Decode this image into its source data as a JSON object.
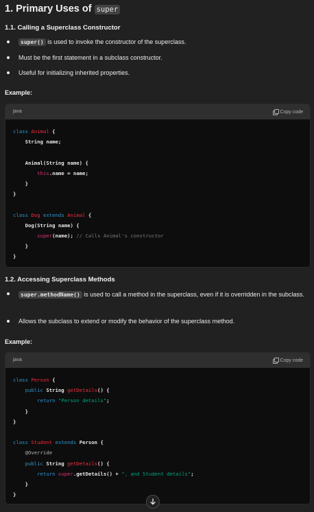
{
  "heading": {
    "prefix": "1. Primary Uses of ",
    "code": "super"
  },
  "section1": {
    "title": "1.1. Calling a Superclass Constructor",
    "bullets": [
      {
        "code": "super()",
        "text": " is used to invoke the constructor of the superclass."
      },
      {
        "text": "Must be the first statement in a subclass constructor."
      },
      {
        "text": "Useful for initializing inherited properties."
      }
    ],
    "example_label": "Example:",
    "code_block": {
      "lang": "java",
      "copy_label": "Copy code",
      "lines": [
        "class Animal {",
        "    String name;",
        "",
        "    Animal(String name) {",
        "        this.name = name;",
        "    }",
        "}",
        "",
        "class Dog extends Animal {",
        "    Dog(String name) {",
        "        super(name); // Calls Animal's constructor",
        "    }",
        "}"
      ]
    }
  },
  "section2": {
    "title": "1.2. Accessing Superclass Methods",
    "bullets": [
      {
        "code": "super.methodName()",
        "text": " is used to call a method in the superclass, even if it is overridden in the subclass."
      },
      {
        "text": "Allows the subclass to extend or modify the behavior of the superclass method."
      }
    ],
    "example_label": "Example:",
    "code_block": {
      "lang": "java",
      "copy_label": "Copy code",
      "lines": [
        "class Person {",
        "    public String getDetails() {",
        "        return \"Person details\";",
        "    }",
        "}",
        "",
        "class Student extends Person {",
        "    @Override",
        "    public String getDetails() {",
        "        return super.getDetails() + \", and Student details\";",
        "    }",
        "}"
      ]
    }
  },
  "scroll_button": {
    "icon": "arrow-down-icon"
  }
}
